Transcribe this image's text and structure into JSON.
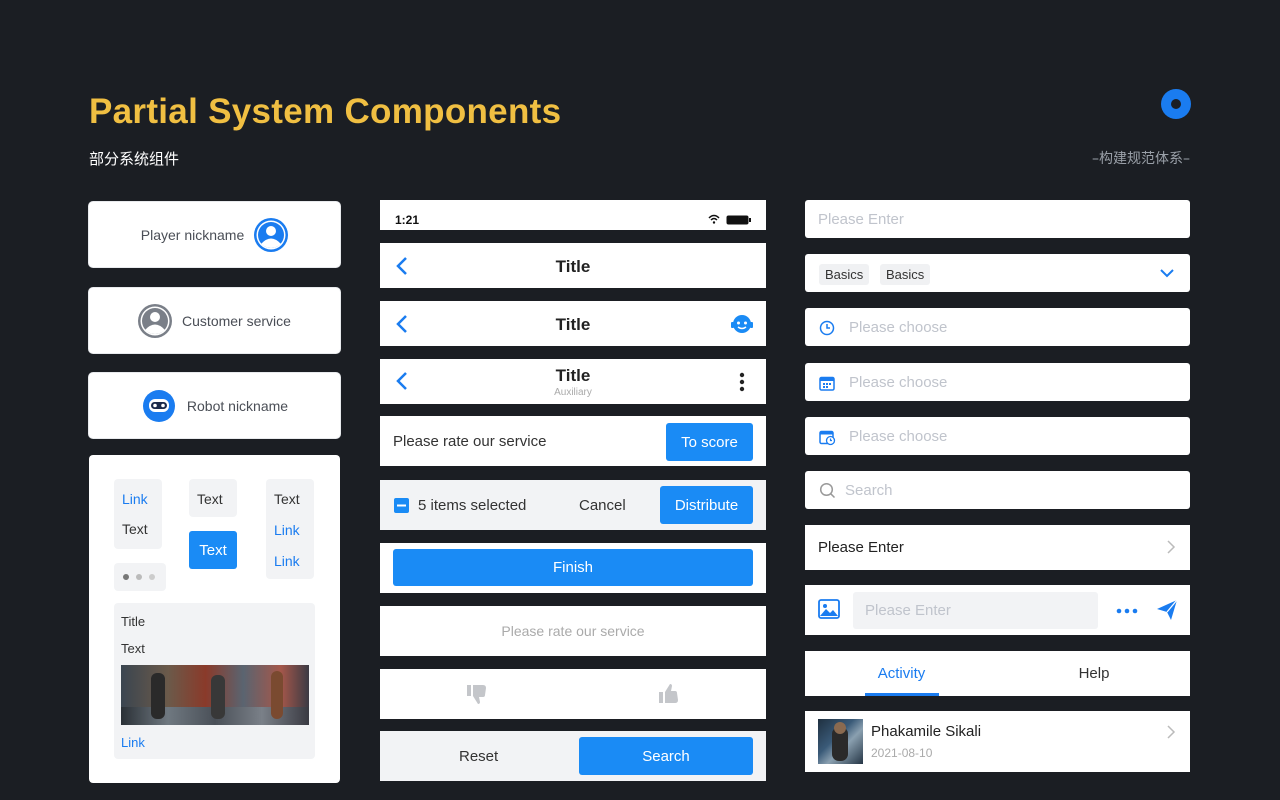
{
  "header": {
    "title": "Partial System Components",
    "subtitle": "部分系统组件",
    "tagline": "–构建规范体系–"
  },
  "colors": {
    "accent": "#1a8bf5",
    "title": "#f0bf42",
    "background": "#1b1e23"
  },
  "left": {
    "player_label": "Player nickname",
    "customer_label": "Customer service",
    "robot_label": "Robot nickname",
    "grid": {
      "col1": [
        "Link",
        "Text"
      ],
      "col2_text": "Text",
      "col2_button": "Text",
      "col3": [
        "Text",
        "Link",
        "Link"
      ]
    },
    "content_card": {
      "title": "Title",
      "text": "Text",
      "link": "Link"
    }
  },
  "middle": {
    "status_time": "1:21",
    "nav1_title": "Title",
    "nav2_title": "Title",
    "nav3_title": "Title",
    "nav3_sub": "Auxiliary",
    "rate_text": "Please rate our service",
    "score_button": "To score",
    "selected_text": "5 items selected",
    "cancel": "Cancel",
    "distribute": "Distribute",
    "finish": "Finish",
    "rate_placeholder": "Please rate our service",
    "reset": "Reset",
    "search": "Search"
  },
  "right": {
    "input1": "Please Enter",
    "chips": [
      "Basics",
      "Basics"
    ],
    "choose1": "Please choose",
    "choose2": "Please choose",
    "choose3": "Please choose",
    "search": "Search",
    "enter_row": "Please Enter",
    "chat_placeholder": "Please Enter",
    "tabs": [
      "Activity",
      "Help"
    ],
    "user_name": "Phakamile Sikali",
    "user_date": "2021-08-10"
  }
}
